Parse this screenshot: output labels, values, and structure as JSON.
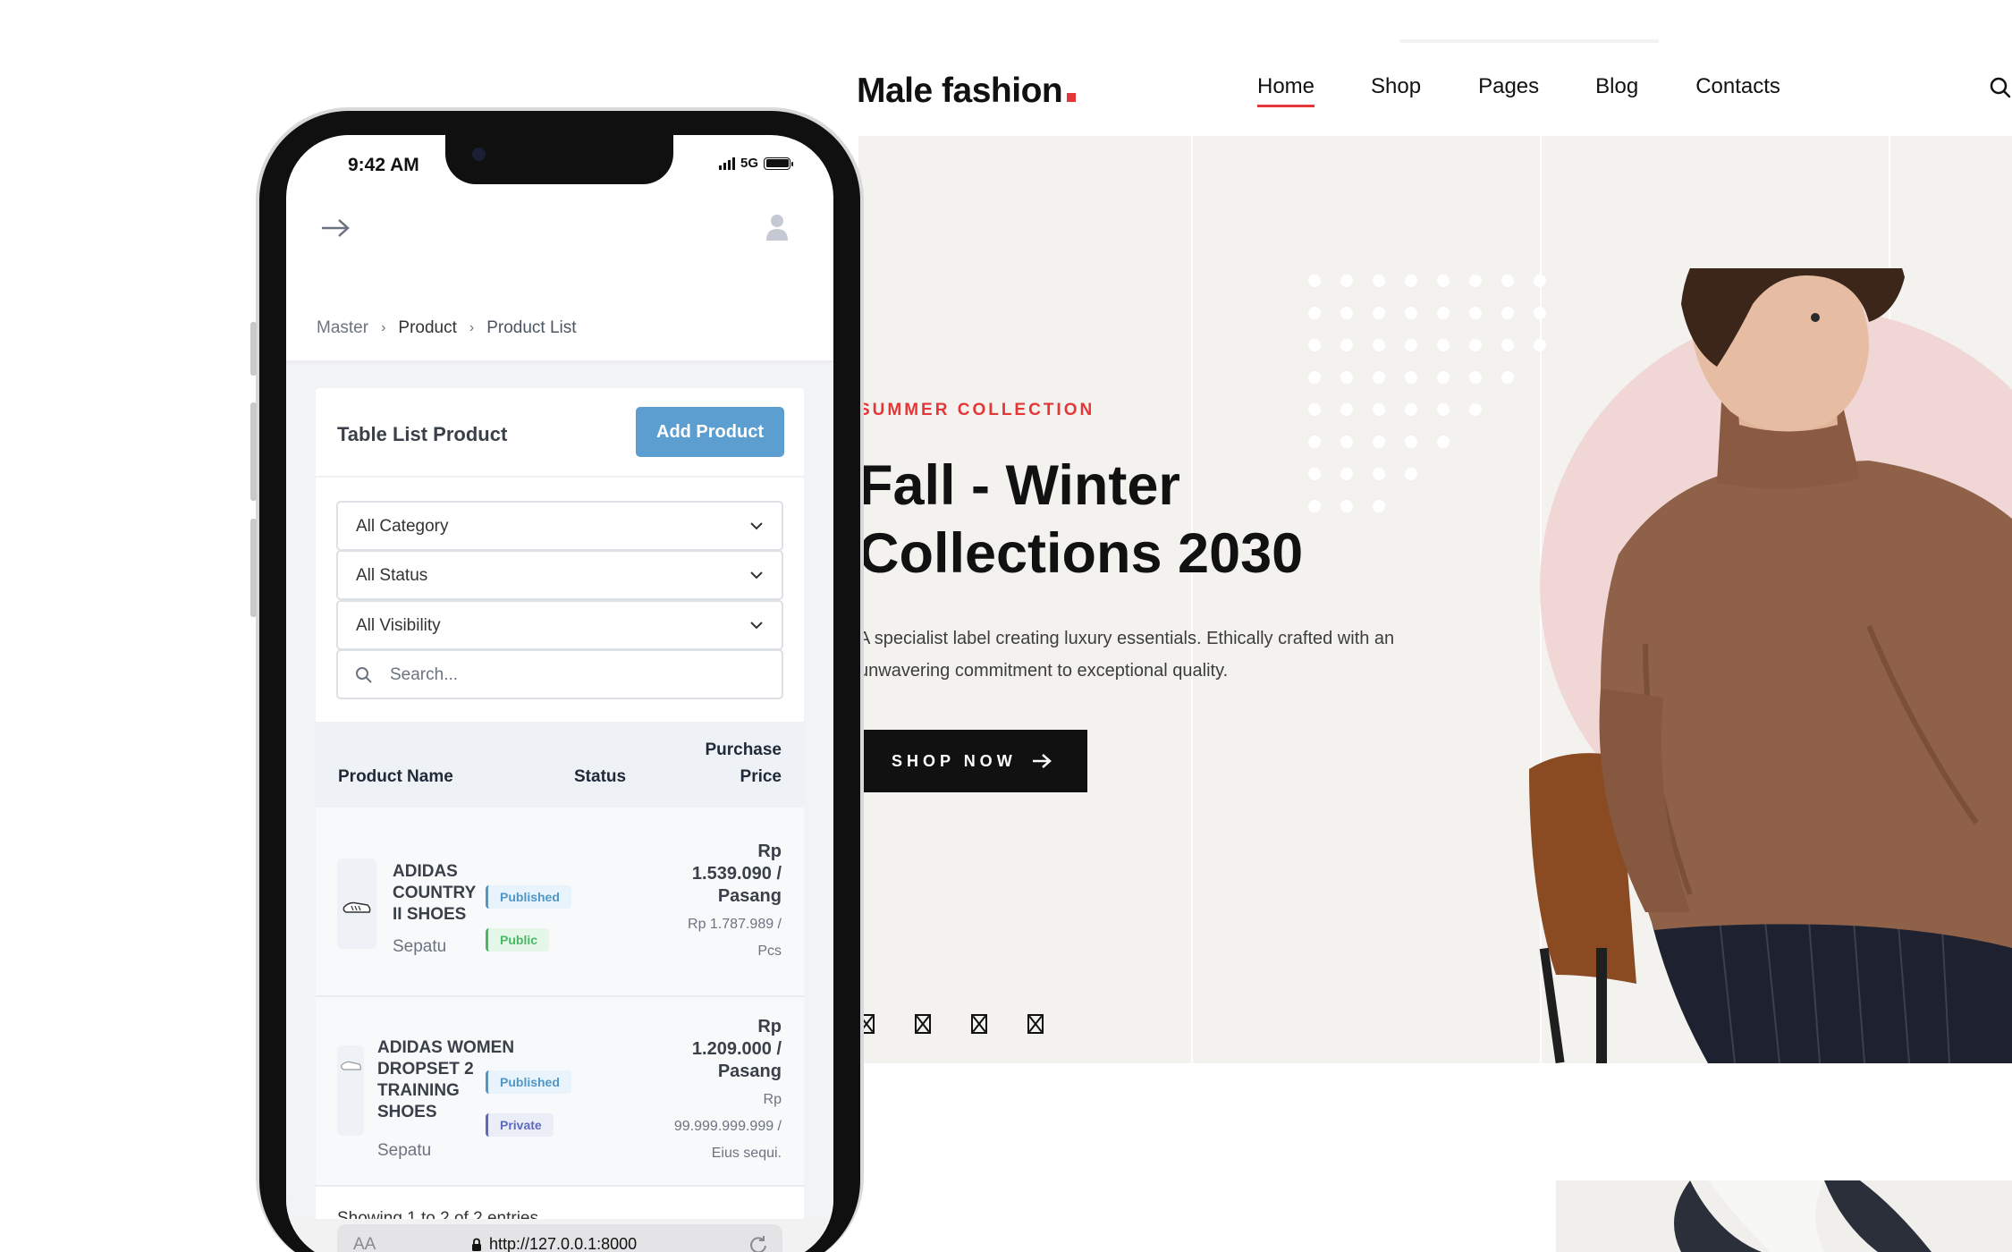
{
  "site": {
    "logo_text": "Male fashion",
    "nav": [
      {
        "label": "Home"
      },
      {
        "label": "Shop"
      },
      {
        "label": "Pages"
      },
      {
        "label": "Blog"
      },
      {
        "label": "Contacts"
      }
    ],
    "hero": {
      "subtitle": "SUMMER COLLECTION",
      "title": "Fall - Winter Collections 2030",
      "text": "A specialist label creating luxury essentials. Ethically crafted with an unwavering commitment to exceptional quality.",
      "button_label": "SHOP NOW"
    },
    "colors": {
      "accent": "#e53637",
      "hero_bg": "#f3f2ee",
      "circle": "#f1d6d6",
      "dark": "#111111"
    }
  },
  "phone": {
    "status": {
      "time": "9:42 AM",
      "network": "5G"
    },
    "breadcrumb": [
      "Master",
      "Product",
      "Product List"
    ],
    "card_title": "Table List Product",
    "add_button": "Add Product",
    "filters": {
      "category": "All Category",
      "status": "All Status",
      "visibility": "All Visibility"
    },
    "search_placeholder": "Search...",
    "table": {
      "headers": {
        "name": "Product Name",
        "status": "Status",
        "price": "Purchase Price"
      },
      "rows": [
        {
          "name": "ADIDAS COUNTRY II SHOES",
          "category": "Sepatu",
          "status": "Published",
          "visibility": "Public",
          "price": "Rp 1.539.090 / Pasang",
          "price_secondary": "Rp 1.787.989 / Pcs"
        },
        {
          "name": "ADIDAS WOMEN DROPSET 2 TRAINING SHOES",
          "category": "Sepatu",
          "status": "Published",
          "visibility": "Private",
          "price": "Rp 1.209.000 / Pasang",
          "price_secondary": "Rp 99.999.999.999 / Eius sequi."
        }
      ]
    },
    "entries_text": "Showing 1 to 2 of 2 entries",
    "url_bar": {
      "aa": "AA",
      "url": "http://127.0.0.1:8000"
    },
    "colors": {
      "primary": "#5c9ecf",
      "published": "#4f97c7",
      "public": "#48b862",
      "private": "#5b6abf"
    }
  }
}
